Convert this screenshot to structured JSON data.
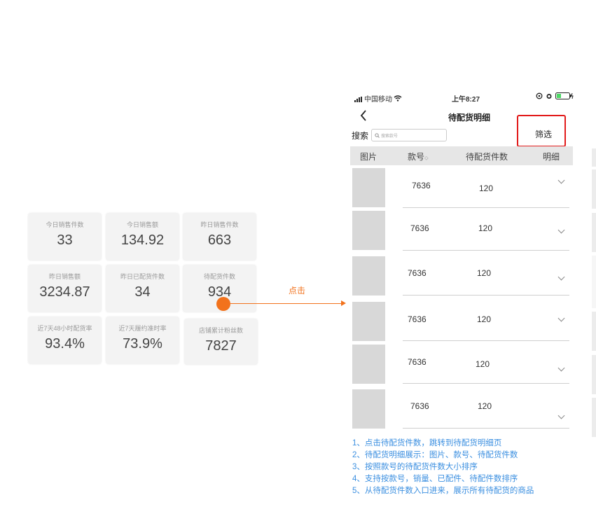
{
  "metrics": [
    {
      "label": "今日销售件数",
      "value": "33"
    },
    {
      "label": "今日销售额",
      "value": "134.92"
    },
    {
      "label": "昨日销售件数",
      "value": "663"
    },
    {
      "label": "昨日销售额",
      "value": "3234.87"
    },
    {
      "label": "昨日已配货件数",
      "value": "34"
    },
    {
      "label": "待配货件数",
      "value": "934"
    },
    {
      "label": "近7天48小时配货率",
      "value": "93.4%"
    },
    {
      "label": "近7天履约准时率",
      "value": "73.9%"
    },
    {
      "label": "店铺累计粉丝数",
      "value": "7827"
    }
  ],
  "click_label": "点击",
  "status_bar": {
    "carrier": "中国移动",
    "time": "上午8:27"
  },
  "nav": {
    "title": "待配货明细"
  },
  "search": {
    "label": "搜索",
    "placeholder": "搜索款号"
  },
  "filter_label": "筛选",
  "table": {
    "headers": {
      "image": "图片",
      "code": "款号",
      "sort_mark": "⬦",
      "qty": "待配货件数",
      "detail": "明细"
    },
    "rows": [
      {
        "code": "7636",
        "qty": "120"
      },
      {
        "code": "7636",
        "qty": "120"
      },
      {
        "code": "7636",
        "qty": "120"
      },
      {
        "code": "7636",
        "qty": "120"
      },
      {
        "code": "7636",
        "qty": "120"
      },
      {
        "code": "7636",
        "qty": "120"
      }
    ]
  },
  "notes": [
    "1、点击待配货件数，跳转到待配货明细页",
    "2、待配货明细展示：图片、款号、待配货件数",
    "3、按照款号的待配货件数大小排序",
    "4、支持按款号，销量、已配件、待配件数排序",
    "5、从待配货件数入口进来，展示所有待配货的商品"
  ],
  "colors": {
    "accent": "#f2721c",
    "highlight": "#e21a1a",
    "notes": "#3b8fe0"
  }
}
